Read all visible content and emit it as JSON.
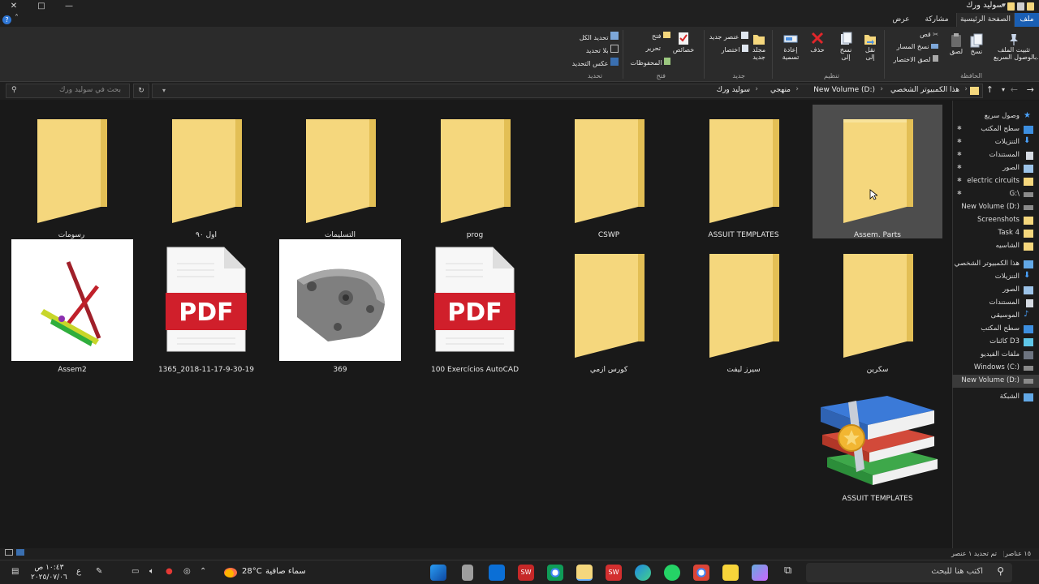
{
  "window": {
    "title": "سوليد ورك",
    "controls": {
      "close": "✕",
      "maximize": "□",
      "minimize": "—"
    }
  },
  "ribbon_tabs": [
    {
      "label": "ملف",
      "state": "file"
    },
    {
      "label": "الصفحة الرئيسية",
      "state": "active"
    },
    {
      "label": "مشاركة",
      "state": "normal"
    },
    {
      "label": "عرض",
      "state": "normal"
    }
  ],
  "ribbon": {
    "clipboard": {
      "group_label": "الحافظة",
      "pin_label_line1": "تثبيت الملف",
      "pin_label_line2": "بالوصول السريع.",
      "copy": "نسخ",
      "paste": "لصق",
      "cut": "قص",
      "copy_path": "نسخ المسار",
      "paste_shortcut": "لصق الاختصار"
    },
    "organize": {
      "group_label": "تنظيم",
      "move_to_line1": "نقل",
      "move_to_line2": "إلى",
      "copy_to_line1": "نسخ",
      "copy_to_line2": "إلى",
      "delete": "حذف",
      "rename_line1": "إعادة",
      "rename_line2": "تسمية"
    },
    "new": {
      "group_label": "جديد",
      "new_folder_line1": "مجلد",
      "new_folder_line2": "جديد",
      "new_item": "عنصر جديد",
      "easy_access": "اختصار"
    },
    "open": {
      "group_label": "فتح",
      "properties": "خصائص",
      "open": "فتح",
      "edit": "تحرير",
      "history": "المحفوظات"
    },
    "select": {
      "group_label": "تحديد",
      "select_all": "تحديد الكل",
      "select_none": "بلا تحديد",
      "invert_selection": "عكس التحديد"
    }
  },
  "address": {
    "breadcrumbs": [
      "هذا الكمبيوتر الشخصي",
      "New Volume (D:)",
      "منهجي",
      "سوليد ورك"
    ],
    "search_placeholder": "بحث في سوليد ورك"
  },
  "items": [
    {
      "name": "Assem. Parts",
      "kind": "folder",
      "selected": true
    },
    {
      "name": "ASSUIT TEMPLATES",
      "kind": "folder"
    },
    {
      "name": "CSWP",
      "kind": "folder"
    },
    {
      "name": "prog",
      "kind": "folder"
    },
    {
      "name": "التسليمات",
      "kind": "folder"
    },
    {
      "name": "اول ٩٠",
      "kind": "folder"
    },
    {
      "name": "رسومات",
      "kind": "folder"
    },
    {
      "name": "سكرين",
      "kind": "folder"
    },
    {
      "name": "سيرز ليفت",
      "kind": "folder"
    },
    {
      "name": "كورس ازمي",
      "kind": "folder"
    },
    {
      "name": "100 Exercícios AutoCAD",
      "kind": "pdf",
      "badge": "PDF"
    },
    {
      "name": "369",
      "kind": "part-thumbnail"
    },
    {
      "name": "1365_2018-11-17-9-30-19",
      "kind": "pdf",
      "badge": "PDF"
    },
    {
      "name": "Assem2",
      "kind": "assembly-thumbnail"
    },
    {
      "name": "ASSUIT TEMPLATES",
      "kind": "winrar-archive"
    }
  ],
  "nav_pane": [
    {
      "label": "وصول سريع",
      "icon": "star-icon",
      "pinned": false
    },
    {
      "label": "سطح المكتب",
      "icon": "desktop-icon",
      "pinned": true
    },
    {
      "label": "التنزيلات",
      "icon": "download-icon",
      "pinned": true
    },
    {
      "label": "المستندات",
      "icon": "document-icon",
      "pinned": true
    },
    {
      "label": "الصور",
      "icon": "pictures-icon",
      "pinned": true
    },
    {
      "label": "electric circuits",
      "icon": "folder-icon",
      "pinned": true
    },
    {
      "label": "G:\\",
      "icon": "drive-icon",
      "pinned": true
    },
    {
      "label": "New Volume (D:)",
      "icon": "drive-icon",
      "pinned": false
    },
    {
      "label": "Screenshots",
      "icon": "folder-icon",
      "pinned": false
    },
    {
      "label": "Task 4",
      "icon": "folder-icon",
      "pinned": false
    },
    {
      "label": "الشاسيه",
      "icon": "folder-icon",
      "pinned": false
    },
    {
      "label": "هذا الكمبيوتر الشخصي",
      "icon": "pc-icon",
      "pinned": false
    },
    {
      "label": "التنزيلات",
      "icon": "download-icon",
      "pinned": false
    },
    {
      "label": "الصور",
      "icon": "pictures-icon",
      "pinned": false
    },
    {
      "label": "المستندات",
      "icon": "document-icon",
      "pinned": false
    },
    {
      "label": "الموسيقى",
      "icon": "music-icon",
      "pinned": false
    },
    {
      "label": "سطح المكتب",
      "icon": "desktop-icon",
      "pinned": false
    },
    {
      "label": "كائنات ثلاثية الأبعاد",
      "display": "كائنات D3",
      "icon": "cube-icon",
      "pinned": false
    },
    {
      "label": "ملفات الفيديو",
      "icon": "video-icon",
      "pinned": false
    },
    {
      "label": "Windows (C:)",
      "icon": "drive-icon",
      "pinned": false
    },
    {
      "label": "New Volume (D:)",
      "icon": "drive-icon",
      "pinned": false,
      "selected": true
    },
    {
      "label": "الشبكة",
      "icon": "network-icon",
      "pinned": false
    }
  ],
  "status": {
    "item_count": "١٥ عناصر",
    "selected": "تم تحديد ١ عنصر"
  },
  "taskbar": {
    "search_placeholder": "اكتب هنا للبحث",
    "weather_temp": "28°C",
    "weather_text": "سماء صافية",
    "time": "١٠:٤٣ ص",
    "date": "٢٠٢٥/٠٧/٠٦",
    "lang": "ع"
  },
  "colors": {
    "folder": "#f5d77d",
    "folder_dark": "#e3bf55",
    "pdf_red": "#d01f2b",
    "accent": "#1a5fb4",
    "selection": "#4d4d4d"
  }
}
